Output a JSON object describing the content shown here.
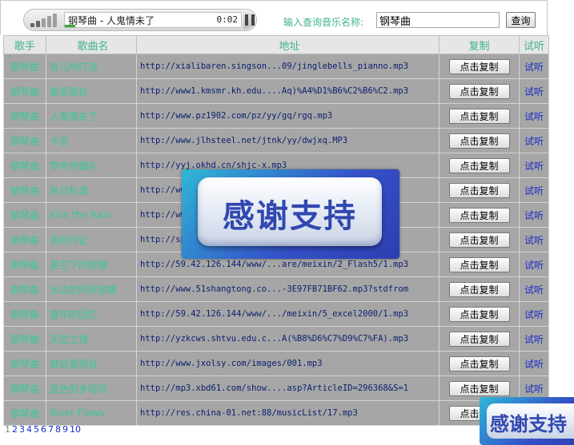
{
  "player": {
    "now_playing": "钢琴曲 - 人鬼情未了",
    "time": "0:02",
    "progress_percent": 6
  },
  "search": {
    "label": "输入查询音乐名称:",
    "value": "钢琴曲",
    "button_label": "查询"
  },
  "table": {
    "headers": [
      "歌手",
      "歌曲名",
      "地址",
      "复制",
      "试听"
    ],
    "copy_label": "点击复制",
    "listen_label": "试听",
    "rows": [
      {
        "singer": "钢琴曲",
        "song": "铃儿响叮当",
        "url": "http://xialibaren.singson...09/jinglebells_pianno.mp3"
      },
      {
        "singer": "钢琴曲",
        "song": "致爱丽丝",
        "url": "http://www1.kmsmr.kh.edu....Aq)%A4%D1%B6%C2%B6%C2.mp3"
      },
      {
        "singer": "钢琴曲",
        "song": "人鬼情未了",
        "url": "http://www.pz1902.com/pz/yy/gq/rgq.mp3"
      },
      {
        "singer": "钢琴曲",
        "song": "卡农",
        "url": "http://www.jlhsteel.net/jtnk/yy/dwjxq.MP3"
      },
      {
        "singer": "钢琴曲",
        "song": "梦中的婚礼",
        "url": "http://yyj.okhd.cn/shjc-x.mp3"
      },
      {
        "singer": "钢琴曲",
        "song": "秋日私语",
        "url": "http://www..."
      },
      {
        "singer": "钢琴曲",
        "song": "Kiss the Rain",
        "url": "http://www..."
      },
      {
        "singer": "钢琴曲",
        "song": "雨的印记",
        "url": "http://sp..."
      },
      {
        "singer": "钢琴曲",
        "song": "星空下的呢喃",
        "url": "http://59.42.126.144/www/...are/meixin/2_Flash5/1.mp3"
      },
      {
        "singer": "钢琴曲",
        "song": "水边的阿狄丽娜",
        "url": "http://www.51shangtong.co...-3E97FB71BF62.mp3?stdfrom"
      },
      {
        "singer": "钢琴曲",
        "song": "童年的回忆",
        "url": "http://59.42.126.144/www/.../meixin/5_excel2000/1.mp3"
      },
      {
        "singer": "钢琴曲",
        "song": "天空之城",
        "url": "http://yzkcws.shtvu.edu.c...A(%B8%D6%C7%D9%C7%FA).mp3"
      },
      {
        "singer": "钢琴曲",
        "song": "献给爱丽丝",
        "url": "http://www.jxolsy.com/images/001.mp3"
      },
      {
        "singer": "钢琴曲",
        "song": "蓝色的多瑙河",
        "url": "http://mp3.xbd61.com/show....asp?ArticleID=296368&S=1"
      },
      {
        "singer": "钢琴曲",
        "song": "River Flows",
        "url": "http://res.china-01.net:88/musicList/17.mp3"
      }
    ]
  },
  "pager": {
    "current": "1",
    "pages": [
      "2",
      "3",
      "4",
      "5",
      "6",
      "7",
      "8",
      "9",
      "10"
    ]
  },
  "banner": {
    "text": "感谢支持"
  },
  "banner_small": {
    "text": "感谢支持"
  }
}
